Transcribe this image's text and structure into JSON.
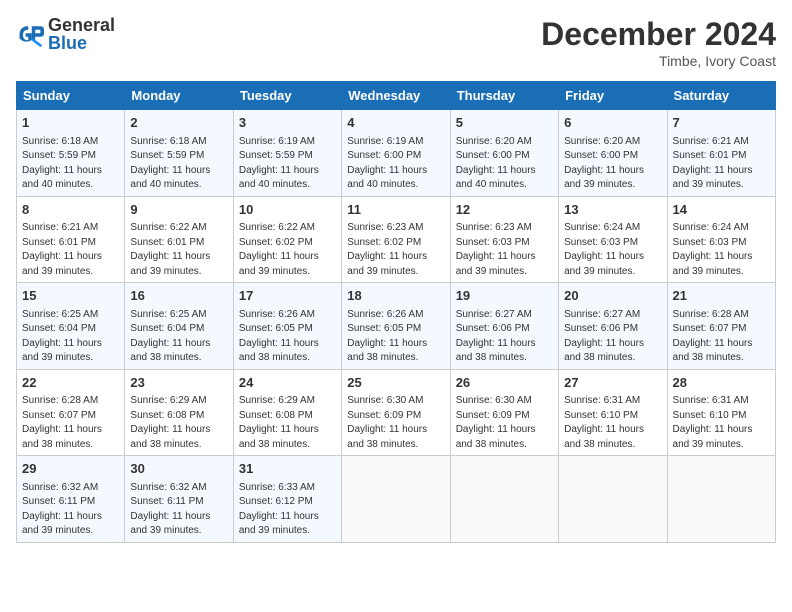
{
  "header": {
    "logo_line1": "General",
    "logo_line2": "Blue",
    "month": "December 2024",
    "location": "Timbe, Ivory Coast"
  },
  "days_of_week": [
    "Sunday",
    "Monday",
    "Tuesday",
    "Wednesday",
    "Thursday",
    "Friday",
    "Saturday"
  ],
  "weeks": [
    [
      {
        "day": 1,
        "rise": "6:18 AM",
        "set": "5:59 PM",
        "hours": "11 hours",
        "mins": "40"
      },
      {
        "day": 2,
        "rise": "6:18 AM",
        "set": "5:59 PM",
        "hours": "11 hours",
        "mins": "40"
      },
      {
        "day": 3,
        "rise": "6:19 AM",
        "set": "5:59 PM",
        "hours": "11 hours",
        "mins": "40"
      },
      {
        "day": 4,
        "rise": "6:19 AM",
        "set": "6:00 PM",
        "hours": "11 hours",
        "mins": "40"
      },
      {
        "day": 5,
        "rise": "6:20 AM",
        "set": "6:00 PM",
        "hours": "11 hours",
        "mins": "40"
      },
      {
        "day": 6,
        "rise": "6:20 AM",
        "set": "6:00 PM",
        "hours": "11 hours",
        "mins": "39"
      },
      {
        "day": 7,
        "rise": "6:21 AM",
        "set": "6:01 PM",
        "hours": "11 hours",
        "mins": "39"
      }
    ],
    [
      {
        "day": 8,
        "rise": "6:21 AM",
        "set": "6:01 PM",
        "hours": "11 hours",
        "mins": "39"
      },
      {
        "day": 9,
        "rise": "6:22 AM",
        "set": "6:01 PM",
        "hours": "11 hours",
        "mins": "39"
      },
      {
        "day": 10,
        "rise": "6:22 AM",
        "set": "6:02 PM",
        "hours": "11 hours",
        "mins": "39"
      },
      {
        "day": 11,
        "rise": "6:23 AM",
        "set": "6:02 PM",
        "hours": "11 hours",
        "mins": "39"
      },
      {
        "day": 12,
        "rise": "6:23 AM",
        "set": "6:03 PM",
        "hours": "11 hours",
        "mins": "39"
      },
      {
        "day": 13,
        "rise": "6:24 AM",
        "set": "6:03 PM",
        "hours": "11 hours",
        "mins": "39"
      },
      {
        "day": 14,
        "rise": "6:24 AM",
        "set": "6:03 PM",
        "hours": "11 hours",
        "mins": "39"
      }
    ],
    [
      {
        "day": 15,
        "rise": "6:25 AM",
        "set": "6:04 PM",
        "hours": "11 hours",
        "mins": "39"
      },
      {
        "day": 16,
        "rise": "6:25 AM",
        "set": "6:04 PM",
        "hours": "11 hours",
        "mins": "38"
      },
      {
        "day": 17,
        "rise": "6:26 AM",
        "set": "6:05 PM",
        "hours": "11 hours",
        "mins": "38"
      },
      {
        "day": 18,
        "rise": "6:26 AM",
        "set": "6:05 PM",
        "hours": "11 hours",
        "mins": "38"
      },
      {
        "day": 19,
        "rise": "6:27 AM",
        "set": "6:06 PM",
        "hours": "11 hours",
        "mins": "38"
      },
      {
        "day": 20,
        "rise": "6:27 AM",
        "set": "6:06 PM",
        "hours": "11 hours",
        "mins": "38"
      },
      {
        "day": 21,
        "rise": "6:28 AM",
        "set": "6:07 PM",
        "hours": "11 hours",
        "mins": "38"
      }
    ],
    [
      {
        "day": 22,
        "rise": "6:28 AM",
        "set": "6:07 PM",
        "hours": "11 hours",
        "mins": "38"
      },
      {
        "day": 23,
        "rise": "6:29 AM",
        "set": "6:08 PM",
        "hours": "11 hours",
        "mins": "38"
      },
      {
        "day": 24,
        "rise": "6:29 AM",
        "set": "6:08 PM",
        "hours": "11 hours",
        "mins": "38"
      },
      {
        "day": 25,
        "rise": "6:30 AM",
        "set": "6:09 PM",
        "hours": "11 hours",
        "mins": "38"
      },
      {
        "day": 26,
        "rise": "6:30 AM",
        "set": "6:09 PM",
        "hours": "11 hours",
        "mins": "38"
      },
      {
        "day": 27,
        "rise": "6:31 AM",
        "set": "6:10 PM",
        "hours": "11 hours",
        "mins": "38"
      },
      {
        "day": 28,
        "rise": "6:31 AM",
        "set": "6:10 PM",
        "hours": "11 hours",
        "mins": "39"
      }
    ],
    [
      {
        "day": 29,
        "rise": "6:32 AM",
        "set": "6:11 PM",
        "hours": "11 hours",
        "mins": "39"
      },
      {
        "day": 30,
        "rise": "6:32 AM",
        "set": "6:11 PM",
        "hours": "11 hours",
        "mins": "39"
      },
      {
        "day": 31,
        "rise": "6:33 AM",
        "set": "6:12 PM",
        "hours": "11 hours",
        "mins": "39"
      },
      null,
      null,
      null,
      null
    ]
  ]
}
